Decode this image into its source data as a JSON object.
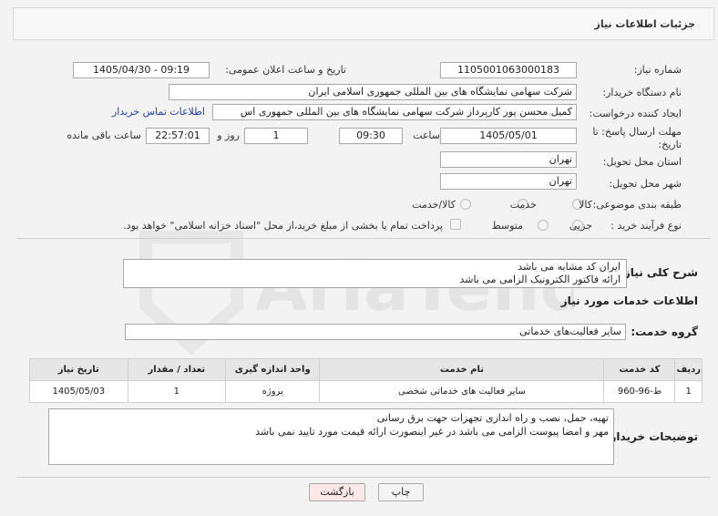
{
  "header": {
    "title": "جزئیات اطلاعات نیاز"
  },
  "form": {
    "need_number_label": "شماره نیاز:",
    "need_number": "1105001063000183",
    "announce_label": "تاریخ و ساعت اعلان عمومی:",
    "announce_value": "1405/04/30 - 09:19",
    "buyer_org_label": "نام دستگاه خریدار:",
    "buyer_org": "شرکت سهامی نمایشگاه های بین المللی جمهوری اسلامی ایران",
    "requester_label": "ایجاد کننده درخواست:",
    "requester": "کمیل محسن پور کارپرداز شرکت سهامی نمایشگاه های بین المللی جمهوری اس",
    "contact_link": "اطلاعات تماس خریدار",
    "deadline_label_1": "مهلت ارسال پاسخ: تا",
    "deadline_label_2": "تاریخ:",
    "deadline_date": "1405/05/01",
    "time_label": "ساعت",
    "deadline_time": "09:30",
    "days_value": "1",
    "days_label": "روز و",
    "remaining_time": "22:57:01",
    "remaining_label": "ساعت باقی مانده",
    "province_label": "استان محل تحویل:",
    "province": "تهران",
    "city_label": "شهر محل تحویل:",
    "city": "تهران",
    "category_label": "طبقه بندی موضوعی:",
    "category_options": [
      "کالا",
      "خدمت",
      "کالا/خدمت"
    ],
    "process_label": "نوع فرآیند خرید :",
    "process_options": [
      "جزیی",
      "متوسط"
    ],
    "payment_note": "پرداخت تمام یا بخشی از مبلغ خرید،از محل \"اسناد خزانه اسلامی\" خواهد بود."
  },
  "summary": {
    "label": "شرح کلی نیاز:",
    "lines": [
      "ایران کد مشابه می باشد",
      "ارائه فاکتور الکترونیک الزامی می باشد"
    ]
  },
  "services": {
    "section_title": "اطلاعات خدمات مورد نیاز",
    "group_label": "گروه خدمت:",
    "group_value": "سایر فعالیت‌های خدماتی",
    "columns": [
      "ردیف",
      "کد خدمت",
      "نام خدمت",
      "واحد اندازه گیری",
      "تعداد / مقدار",
      "تاریخ نیاز"
    ],
    "rows": [
      [
        "1",
        "ط-96-960",
        "سایر فعالیت های خدماتی شخصی",
        "پروژه",
        "1",
        "1405/05/03"
      ]
    ]
  },
  "buyer_notes": {
    "label": "توضیحات خریدار:",
    "lines": [
      "تهیه، حمل، نصب و راه اندازی تجهزات جهت برق رسانی",
      "مهر و امضا پیوست الزامی می باشد در غیر اینصورت ارائه قیمت مورد تایید نمی باشد"
    ]
  },
  "buttons": {
    "print": "چاپ",
    "back": "بازگشت"
  },
  "colors": {
    "link": "#1e3fb0",
    "back_button_bg": "#fde8e8",
    "print_button_bg": "#f4f4f4"
  }
}
